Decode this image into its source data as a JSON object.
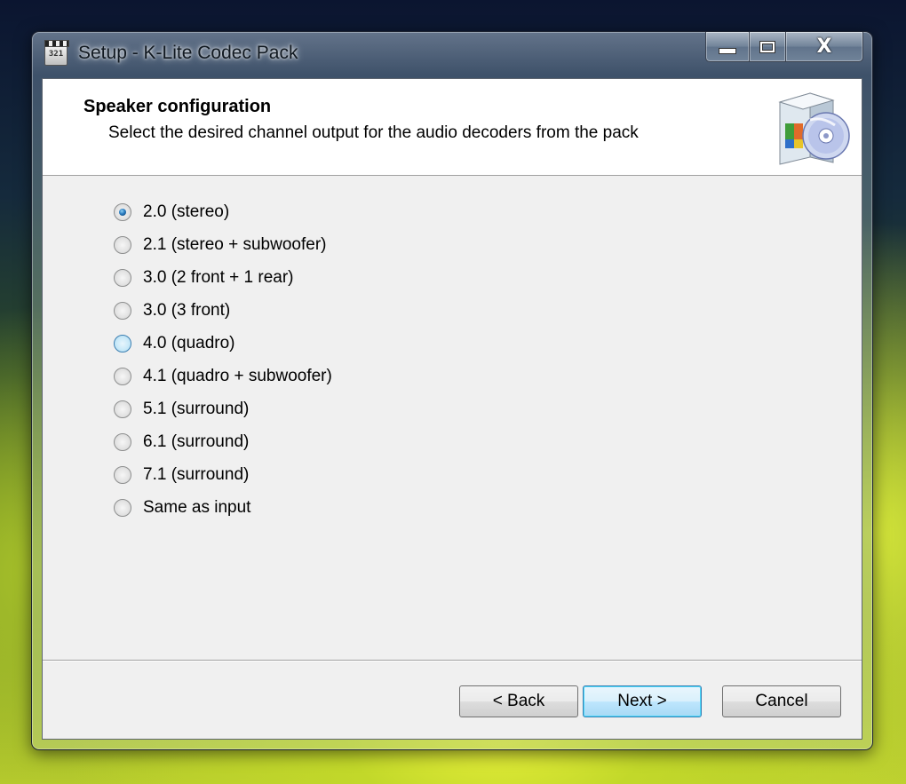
{
  "window": {
    "title": "Setup - K-Lite Codec Pack",
    "app_icon_text": "321",
    "controls": {
      "minimize": "minimize",
      "maximize": "maximize",
      "close_glyph": "X"
    }
  },
  "header": {
    "title": "Speaker configuration",
    "subtitle": "Select the desired channel output for the audio decoders from the pack",
    "icon": "software-box-cd-icon"
  },
  "options": [
    {
      "label": "2.0 (stereo)",
      "checked": true
    },
    {
      "label": "2.1 (stereo + subwoofer)",
      "checked": false
    },
    {
      "label": "3.0 (2 front + 1 rear)",
      "checked": false
    },
    {
      "label": "3.0 (3 front)",
      "checked": false
    },
    {
      "label": "4.0 (quadro)",
      "checked": false,
      "hover": true
    },
    {
      "label": "4.1 (quadro + subwoofer)",
      "checked": false
    },
    {
      "label": "5.1 (surround)",
      "checked": false
    },
    {
      "label": "6.1 (surround)",
      "checked": false
    },
    {
      "label": "7.1 (surround)",
      "checked": false
    },
    {
      "label": "Same as input",
      "checked": false
    }
  ],
  "buttons": {
    "back": "< Back",
    "next": "Next >",
    "cancel": "Cancel"
  },
  "colors": {
    "accent": "#3c7fb1",
    "dialog_bg": "#f0f0f0",
    "header_bg": "#ffffff"
  }
}
